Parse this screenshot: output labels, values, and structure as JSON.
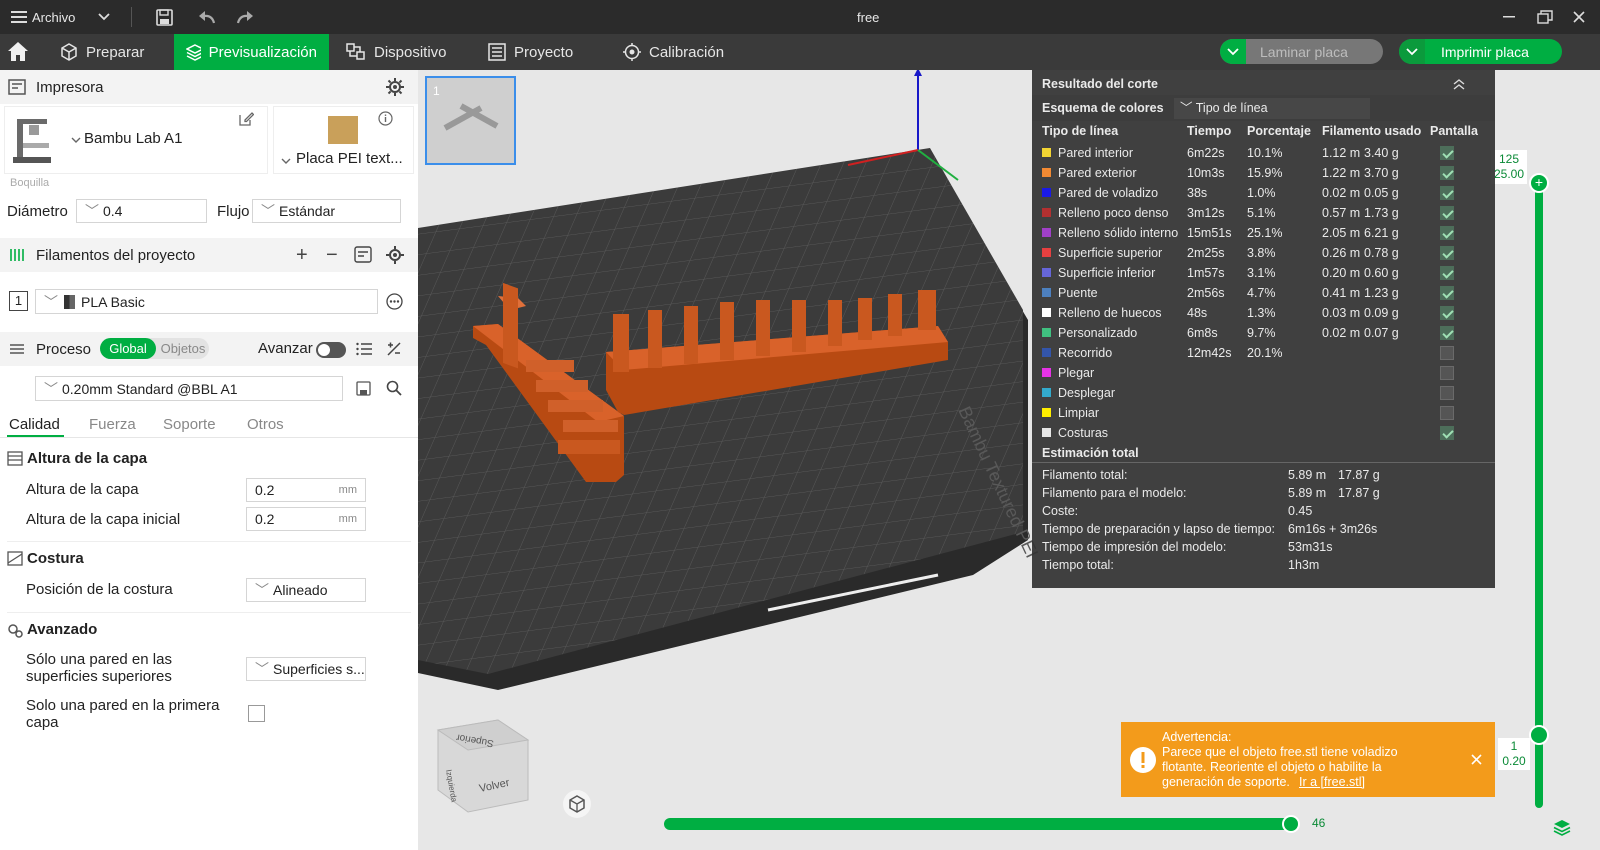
{
  "titlebar": {
    "menu_label": "Archivo",
    "window_title": "free"
  },
  "nav": {
    "tabs": [
      {
        "label": "Preparar"
      },
      {
        "label": "Previsualización"
      },
      {
        "label": "Dispositivo"
      },
      {
        "label": "Proyecto"
      },
      {
        "label": "Calibración"
      }
    ],
    "slice_btn": "Laminar placa",
    "print_btn": "Imprimir placa"
  },
  "printer": {
    "section": "Impresora",
    "name": "Bambu Lab A1",
    "plate": "Placa PEI text...",
    "nozzle_label": "Boquilla",
    "diameter_label": "Diámetro",
    "diameter_value": "0.4",
    "flow_label": "Flujo",
    "flow_value": "Estándar"
  },
  "filaments": {
    "section": "Filamentos del proyecto",
    "index": "1",
    "name": "PLA Basic"
  },
  "process": {
    "section": "Proceso",
    "toggle_global": "Global",
    "toggle_objects": "Objetos",
    "advance_label": "Avanzar",
    "profile": "0.20mm Standard @BBL A1",
    "tabs": [
      "Calidad",
      "Fuerza",
      "Soporte",
      "Otros"
    ]
  },
  "quality": {
    "layer_group": "Altura de la capa",
    "layer_height_label": "Altura de la capa",
    "layer_height_value": "0.2",
    "initial_layer_label": "Altura de la capa inicial",
    "initial_layer_value": "0.2",
    "unit": "mm",
    "seam_group": "Costura",
    "seam_pos_label": "Posición de la costura",
    "seam_pos_value": "Alineado",
    "advanced_group": "Avanzado",
    "single_wall_top_label1": "Sólo una pared en las",
    "single_wall_top_label2": "superficies superiores",
    "single_wall_top_value": "Superficies s...",
    "single_wall_first_label1": "Solo una pared en la primera",
    "single_wall_first_label2": "capa"
  },
  "plate_thumb": {
    "index": "1"
  },
  "result": {
    "title": "Resultado del corte",
    "scheme_label": "Esquema de colores",
    "scheme_value": "Tipo de línea",
    "headers": [
      "Tipo de línea",
      "Tiempo",
      "Porcentaje",
      "Filamento usado",
      "Pantalla"
    ],
    "rows": [
      {
        "name": "Pared interior",
        "color": "#f2d433",
        "time": "6m22s",
        "pct": "10.1%",
        "len": "1.12 m",
        "wt": "3.40 g",
        "show": true
      },
      {
        "name": "Pared exterior",
        "color": "#f28a33",
        "time": "10m3s",
        "pct": "15.9%",
        "len": "1.22 m",
        "wt": "3.70 g",
        "show": true
      },
      {
        "name": "Pared de voladizo",
        "color": "#1a1ae6",
        "time": "38s",
        "pct": "1.0%",
        "len": "0.02 m",
        "wt": "0.05 g",
        "show": true
      },
      {
        "name": "Relleno poco denso",
        "color": "#b33030",
        "time": "3m12s",
        "pct": "5.1%",
        "len": "0.57 m",
        "wt": "1.73 g",
        "show": true
      },
      {
        "name": "Relleno sólido interno",
        "color": "#a040c8",
        "time": "15m51s",
        "pct": "25.1%",
        "len": "2.05 m",
        "wt": "6.21 g",
        "show": true
      },
      {
        "name": "Superficie superior",
        "color": "#e64040",
        "time": "2m25s",
        "pct": "3.8%",
        "len": "0.26 m",
        "wt": "0.78 g",
        "show": true
      },
      {
        "name": "Superficie inferior",
        "color": "#6666d9",
        "time": "1m57s",
        "pct": "3.1%",
        "len": "0.20 m",
        "wt": "0.60 g",
        "show": true
      },
      {
        "name": "Puente",
        "color": "#4d80bf",
        "time": "2m56s",
        "pct": "4.7%",
        "len": "0.41 m",
        "wt": "1.23 g",
        "show": true
      },
      {
        "name": "Relleno de huecos",
        "color": "#ffffff",
        "time": "48s",
        "pct": "1.3%",
        "len": "0.03 m",
        "wt": "0.09 g",
        "show": true
      },
      {
        "name": "Personalizado",
        "color": "#40c080",
        "time": "6m8s",
        "pct": "9.7%",
        "len": "0.02 m",
        "wt": "0.07 g",
        "show": true
      },
      {
        "name": "Recorrido",
        "color": "#3355aa",
        "time": "12m42s",
        "pct": "20.1%",
        "len": "",
        "wt": "",
        "show": false
      },
      {
        "name": "Plegar",
        "color": "#e633e6",
        "time": "",
        "pct": "",
        "len": "",
        "wt": "",
        "show": false
      },
      {
        "name": "Desplegar",
        "color": "#33aacc",
        "time": "",
        "pct": "",
        "len": "",
        "wt": "",
        "show": false
      },
      {
        "name": "Limpiar",
        "color": "#ffee00",
        "time": "",
        "pct": "",
        "len": "",
        "wt": "",
        "show": false
      },
      {
        "name": "Costuras",
        "color": "#e6e6e6",
        "time": "",
        "pct": "",
        "len": "",
        "wt": "",
        "show": true
      }
    ],
    "estimate_title": "Estimación total",
    "estimates": [
      {
        "label": "Filamento total:",
        "v1": "5.89 m",
        "v2": "17.87 g"
      },
      {
        "label": "Filamento para el modelo:",
        "v1": "5.89 m",
        "v2": "17.87 g"
      },
      {
        "label": "Coste:",
        "v1": "0.45",
        "v2": ""
      },
      {
        "label": "Tiempo de preparación y lapso de tiempo:",
        "v1": "6m16s + 3m26s",
        "v2": ""
      },
      {
        "label": "Tiempo de impresión del modelo:",
        "v1": "53m31s",
        "v2": ""
      },
      {
        "label": "Tiempo total:",
        "v1": "1h3m",
        "v2": ""
      }
    ]
  },
  "layer_slider": {
    "top_layer": "125",
    "top_height": "25.00",
    "bottom_layer": "1",
    "bottom_height": "0.20"
  },
  "move_slider": {
    "value": "46"
  },
  "navcube": {
    "top": "Superior",
    "front": "Volver",
    "side": "Izquierda"
  },
  "plate_label": "Bambu Textured PEI",
  "warning": {
    "title": "Advertencia:",
    "line1": "Parece que el objeto free.stl tiene voladizo",
    "line2": "flotante. Reoriente el objeto o habilite la",
    "line3": "generación de soporte.",
    "link": "Ir a [free.stl]"
  }
}
